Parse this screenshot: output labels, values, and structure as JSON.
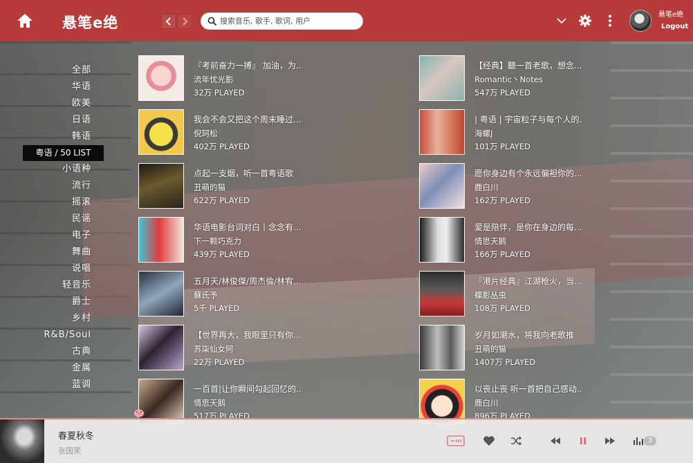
{
  "header": {
    "logo": "悬笔e绝",
    "search_placeholder": "搜索音乐, 歌手, 歌词, 用户",
    "user_name": "悬笔e绝",
    "logout": "Logout"
  },
  "categories": [
    {
      "label": "全部"
    },
    {
      "label": "华语"
    },
    {
      "label": "欧美"
    },
    {
      "label": "日语"
    },
    {
      "label": "韩语"
    },
    {
      "label": "粤语 / 50 LIST",
      "active": true
    },
    {
      "label": "小语种"
    },
    {
      "label": "流行"
    },
    {
      "label": "摇滚"
    },
    {
      "label": "民谣"
    },
    {
      "label": "电子"
    },
    {
      "label": "舞曲"
    },
    {
      "label": "说唱"
    },
    {
      "label": "轻音乐"
    },
    {
      "label": "爵士"
    },
    {
      "label": "乡村"
    },
    {
      "label": "R&B/Soul"
    },
    {
      "label": "古典"
    },
    {
      "label": "金属"
    },
    {
      "label": "蓝调"
    }
  ],
  "playlists": [
    {
      "title": "『考前奋力一搏』 加油，为..",
      "author": "流年忧光影",
      "played": "32万 PLAYED"
    },
    {
      "title": "【经典】聽一首老歌，想念...",
      "author": "Romantic丶Notes",
      "played": "547万 PLAYED"
    },
    {
      "title": "我会不会又把这个周末睡过...",
      "author": "倪珂松",
      "played": "402万 PLAYED"
    },
    {
      "title": "| 粤语 | 宇宙粒子与每个人的.",
      "author": "海螺J",
      "played": "101万 PLAYED"
    },
    {
      "title": "点起一支烟，听一首粤语歌",
      "author": "丑萌的猫",
      "played": "622万 PLAYED"
    },
    {
      "title": "愿你身边有个永远偏袒你的...",
      "author": "鹿白川",
      "played": "162万 PLAYED"
    },
    {
      "title": "华语电影台词对白丨念念有...",
      "author": "下一颗巧克力",
      "played": "439万 PLAYED"
    },
    {
      "title": "爱是陪伴，是你在身边的每...",
      "author": "情思天鹅",
      "played": "166万 PLAYED"
    },
    {
      "title": "五月天/林俊傑/周杰倫/林宥...",
      "author": "蘇氏予",
      "played": "5千 PLAYED"
    },
    {
      "title": "『港片经典』江湖枪火，当...",
      "author": "蝶影丛虫",
      "played": "108万 PLAYED"
    },
    {
      "title": "【世界再大，我眼里只有你...",
      "author": "苏柒仙女阿",
      "played": "22万 PLAYED"
    },
    {
      "title": "岁月如潮水，将我向老歌推",
      "author": "丑萌的猫",
      "played": "1407万 PLAYED"
    },
    {
      "title": "一百首|让你瞬间勾起回忆的..",
      "author": "情思天鹅",
      "played": "517万 PLAYED"
    },
    {
      "title": "以丧止丧 听一首把自己感动..",
      "author": "鹿白川",
      "played": "896万 PLAYED"
    }
  ],
  "player": {
    "title": "春夏秋冬",
    "artist": "张国荣",
    "queue_count": "3"
  },
  "colors": {
    "header_bg": "#b83b3c",
    "accent": "#e0607a",
    "player_bg": "#eeeeee"
  }
}
